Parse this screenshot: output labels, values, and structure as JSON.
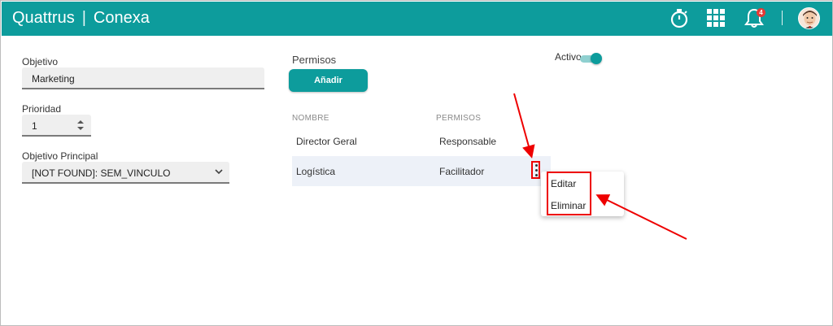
{
  "header": {
    "brand_left": "Quattrus",
    "brand_sep": "|",
    "brand_right": "Conexa",
    "notification_count": "4",
    "bg_color": "#0d9c9c"
  },
  "form": {
    "objetivo_label": "Objetivo",
    "objetivo_value": "Marketing",
    "prioridad_label": "Prioridad",
    "prioridad_value": "1",
    "principal_label": "Objetivo Principal",
    "principal_value": "[NOT FOUND]: SEM_VINCULO"
  },
  "permissions": {
    "title": "Permisos",
    "add_button": "Añadir",
    "col_name": "NOMBRE",
    "col_perm": "PERMISOS",
    "rows": [
      {
        "name": "Director Geral",
        "perm": "Responsable"
      },
      {
        "name": "Logística",
        "perm": "Facilitador"
      }
    ]
  },
  "toggle": {
    "label": "Activo",
    "state": "on"
  },
  "context_menu": {
    "items": [
      "Editar",
      "Eliminar"
    ]
  },
  "colors": {
    "accent": "#0d9c9c",
    "annotation": "#e00000",
    "row_highlight": "#edf1f8"
  }
}
